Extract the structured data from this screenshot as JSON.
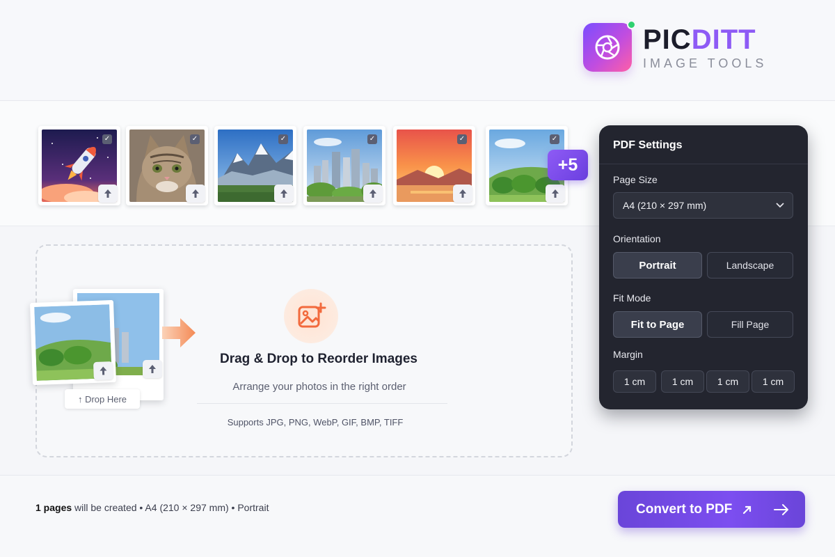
{
  "brand": {
    "name_part1": "PIC",
    "name_part2": "DITT",
    "tagline": "IMAGE TOOLS",
    "accent": "#8e5bf5",
    "status_dot": "#2fd170"
  },
  "thumbnails": [
    {
      "subject": "rocket",
      "checked": true
    },
    {
      "subject": "cat",
      "checked": true
    },
    {
      "subject": "snowy-mountains",
      "checked": true
    },
    {
      "subject": "city-skyline",
      "checked": true
    },
    {
      "subject": "sunset",
      "checked": true
    },
    {
      "subject": "green-hills",
      "checked": true
    }
  ],
  "more_count": "+5",
  "dropzone": {
    "title": "Drag & Drop to Reorder Images",
    "subtitle": "Arrange your photos in the right order",
    "supports": "Supports JPG, PNG, WebP, GIF, BMP, TIFF",
    "drop_here": "↑ Drop Here"
  },
  "settings": {
    "title": "PDF Settings",
    "page_size_label": "Page Size",
    "page_size_value": "A4 (210 × 297 mm)",
    "orientation_label": "Orientation",
    "orientation_options": [
      "Portrait",
      "Landscape"
    ],
    "orientation_selected": "Portrait",
    "fit_mode_label": "Fit Mode",
    "fit_mode_options": [
      "Fit to Page",
      "Fill Page"
    ],
    "fit_mode_selected": "Fit to Page",
    "margin_label": "Margin",
    "margins": [
      "1 cm",
      "1 cm",
      "1 cm",
      "1 cm"
    ]
  },
  "footer": {
    "pages_count": "1 pages",
    "info_rest": " will be created • A4 (210 × 297 mm) • Portrait",
    "convert_label": "Convert to PDF"
  }
}
